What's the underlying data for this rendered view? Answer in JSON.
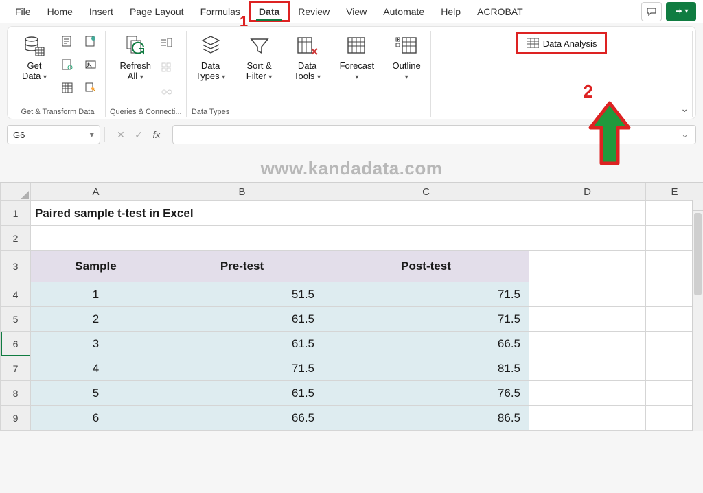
{
  "annotations": {
    "step1": "1",
    "step2": "2"
  },
  "tabs": {
    "items": [
      "File",
      "Home",
      "Insert",
      "Page Layout",
      "Formulas",
      "Data",
      "Review",
      "View",
      "Automate",
      "Help",
      "ACROBAT"
    ],
    "active_index": 5
  },
  "ribbon": {
    "get_data": {
      "label_line1": "Get",
      "label_line2": "Data"
    },
    "group_transform": "Get & Transform Data",
    "refresh": {
      "label_line1": "Refresh",
      "label_line2": "All"
    },
    "group_queries": "Queries & Connecti...",
    "data_types": {
      "label_line1": "Data",
      "label_line2": "Types"
    },
    "group_types": "Data Types",
    "sort_filter": {
      "label_line1": "Sort &",
      "label_line2": "Filter"
    },
    "data_tools": {
      "label_line1": "Data",
      "label_line2": "Tools"
    },
    "forecast": {
      "label": "Forecast"
    },
    "outline": {
      "label": "Outline"
    },
    "data_analysis": "Data Analysis"
  },
  "namebox": "G6",
  "watermark": "www.kandadata.com",
  "columns": [
    "A",
    "B",
    "C",
    "D",
    "E"
  ],
  "rows": [
    "1",
    "2",
    "3",
    "4",
    "5",
    "6",
    "7",
    "8",
    "9"
  ],
  "title_cell": "Paired sample t-test in Excel",
  "table": {
    "headers": [
      "Sample",
      "Pre-test",
      "Post-test"
    ],
    "data": [
      [
        "1",
        "51.5",
        "71.5"
      ],
      [
        "2",
        "61.5",
        "71.5"
      ],
      [
        "3",
        "61.5",
        "66.5"
      ],
      [
        "4",
        "71.5",
        "81.5"
      ],
      [
        "5",
        "61.5",
        "76.5"
      ],
      [
        "6",
        "66.5",
        "86.5"
      ]
    ]
  },
  "colors": {
    "accent": "#107c41",
    "callout": "#d22",
    "header_fill": "#e3deea",
    "data_fill": "#deecf0"
  }
}
